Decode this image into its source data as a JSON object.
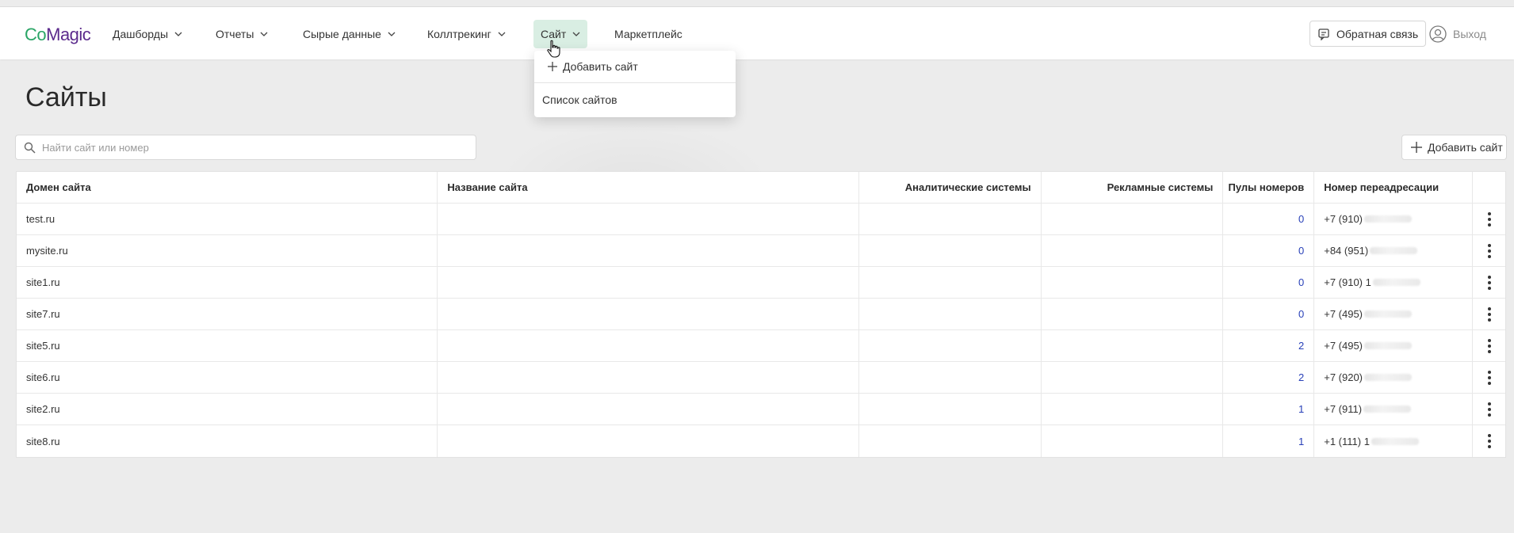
{
  "logo": {
    "part1": "Co",
    "part2": "Magic"
  },
  "nav": {
    "dashboards": "Дашборды",
    "reports": "Отчеты",
    "raw_data": "Сырые данные",
    "calltracking": "Коллтрекинг",
    "site": "Сайт",
    "marketplace": "Маркетплейс"
  },
  "header_right": {
    "feedback": "Обратная связь",
    "logout": "Выход"
  },
  "site_menu": {
    "add_site": "Добавить сайт",
    "site_list": "Список сайтов"
  },
  "page": {
    "title": "Сайты",
    "search_placeholder": "Найти сайт или номер",
    "add_site_button": "Добавить сайт"
  },
  "table": {
    "headers": {
      "domain": "Домен сайта",
      "name": "Название сайта",
      "analytics": "Аналитические системы",
      "ads": "Рекламные системы",
      "pools": "Пулы номеров",
      "forward": "Номер переадресации"
    },
    "rows": [
      {
        "domain": "test.ru",
        "name": "",
        "analytics": "",
        "ads": "",
        "pools": "0",
        "forward": "+7 (910) "
      },
      {
        "domain": "mysite.ru",
        "name": "",
        "analytics": "",
        "ads": "",
        "pools": "0",
        "forward": "+84 (951) "
      },
      {
        "domain": "site1.ru",
        "name": "",
        "analytics": "",
        "ads": "",
        "pools": "0",
        "forward": "+7 (910) 1"
      },
      {
        "domain": "site7.ru",
        "name": "",
        "analytics": "",
        "ads": "",
        "pools": "0",
        "forward": "+7 (495) "
      },
      {
        "domain": "site5.ru",
        "name": "",
        "analytics": "",
        "ads": "",
        "pools": "2",
        "forward": "+7 (495) "
      },
      {
        "domain": "site6.ru",
        "name": "",
        "analytics": "",
        "ads": "",
        "pools": "2",
        "forward": "+7 (920) "
      },
      {
        "domain": "site2.ru",
        "name": "",
        "analytics": "",
        "ads": "",
        "pools": "1",
        "forward": "+7 (911) "
      },
      {
        "domain": "site8.ru",
        "name": "",
        "analytics": "",
        "ads": "",
        "pools": "1",
        "forward": "+1 (111) 1"
      }
    ]
  },
  "colors": {
    "accent_green": "#2aa566",
    "brand_purple": "#5b2a8c",
    "link_blue": "#2840b8",
    "active_nav_bg": "#d9eee3"
  }
}
